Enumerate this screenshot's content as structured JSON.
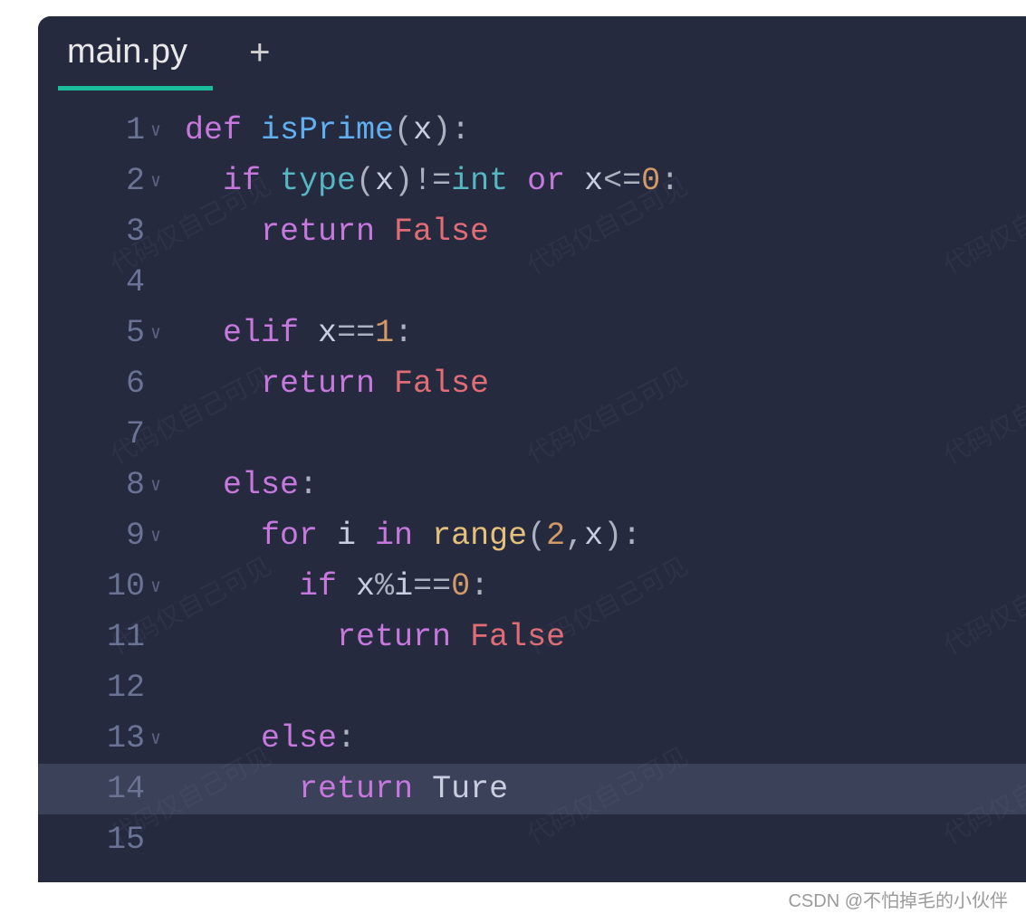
{
  "tab": {
    "filename": "main.py"
  },
  "lines": [
    {
      "num": "1",
      "fold": true,
      "highlight": false,
      "tokens": [
        {
          "t": "def ",
          "c": "tok-keyword"
        },
        {
          "t": "isPrime",
          "c": "tok-funcname"
        },
        {
          "t": "(",
          "c": "tok-punct"
        },
        {
          "t": "x",
          "c": "tok-ident"
        },
        {
          "t": "):",
          "c": "tok-punct"
        }
      ]
    },
    {
      "num": "2",
      "fold": true,
      "highlight": false,
      "tokens": [
        {
          "t": "  ",
          "c": ""
        },
        {
          "t": "if ",
          "c": "tok-keyword"
        },
        {
          "t": "type",
          "c": "tok-builtin"
        },
        {
          "t": "(",
          "c": "tok-punct"
        },
        {
          "t": "x",
          "c": "tok-ident"
        },
        {
          "t": ")",
          "c": "tok-punct"
        },
        {
          "t": "!=",
          "c": "tok-op"
        },
        {
          "t": "int ",
          "c": "tok-builtin"
        },
        {
          "t": "or ",
          "c": "tok-keyword"
        },
        {
          "t": "x",
          "c": "tok-ident"
        },
        {
          "t": "<=",
          "c": "tok-op"
        },
        {
          "t": "0",
          "c": "tok-number"
        },
        {
          "t": ":",
          "c": "tok-punct"
        }
      ]
    },
    {
      "num": "3",
      "fold": false,
      "highlight": false,
      "tokens": [
        {
          "t": "    ",
          "c": ""
        },
        {
          "t": "return ",
          "c": "tok-keyword"
        },
        {
          "t": "False",
          "c": "tok-const"
        }
      ]
    },
    {
      "num": "4",
      "fold": false,
      "highlight": false,
      "tokens": []
    },
    {
      "num": "5",
      "fold": true,
      "highlight": false,
      "tokens": [
        {
          "t": "  ",
          "c": ""
        },
        {
          "t": "elif ",
          "c": "tok-keyword"
        },
        {
          "t": "x",
          "c": "tok-ident"
        },
        {
          "t": "==",
          "c": "tok-op"
        },
        {
          "t": "1",
          "c": "tok-number"
        },
        {
          "t": ":",
          "c": "tok-punct"
        }
      ]
    },
    {
      "num": "6",
      "fold": false,
      "highlight": false,
      "tokens": [
        {
          "t": "    ",
          "c": ""
        },
        {
          "t": "return ",
          "c": "tok-keyword"
        },
        {
          "t": "False",
          "c": "tok-const"
        }
      ]
    },
    {
      "num": "7",
      "fold": false,
      "highlight": false,
      "tokens": []
    },
    {
      "num": "8",
      "fold": true,
      "highlight": false,
      "tokens": [
        {
          "t": "  ",
          "c": ""
        },
        {
          "t": "else",
          "c": "tok-keyword"
        },
        {
          "t": ":",
          "c": "tok-punct"
        }
      ]
    },
    {
      "num": "9",
      "fold": true,
      "highlight": false,
      "tokens": [
        {
          "t": "    ",
          "c": ""
        },
        {
          "t": "for ",
          "c": "tok-keyword"
        },
        {
          "t": "i ",
          "c": "tok-ident"
        },
        {
          "t": "in ",
          "c": "tok-keyword"
        },
        {
          "t": "range",
          "c": "tok-rangecall"
        },
        {
          "t": "(",
          "c": "tok-punct"
        },
        {
          "t": "2",
          "c": "tok-number"
        },
        {
          "t": ",",
          "c": "tok-punct"
        },
        {
          "t": "x",
          "c": "tok-ident"
        },
        {
          "t": "):",
          "c": "tok-punct"
        }
      ]
    },
    {
      "num": "10",
      "fold": true,
      "highlight": false,
      "tokens": [
        {
          "t": "      ",
          "c": ""
        },
        {
          "t": "if ",
          "c": "tok-keyword"
        },
        {
          "t": "x",
          "c": "tok-ident"
        },
        {
          "t": "%",
          "c": "tok-op"
        },
        {
          "t": "i",
          "c": "tok-ident"
        },
        {
          "t": "==",
          "c": "tok-op"
        },
        {
          "t": "0",
          "c": "tok-number"
        },
        {
          "t": ":",
          "c": "tok-punct"
        }
      ]
    },
    {
      "num": "11",
      "fold": false,
      "highlight": false,
      "tokens": [
        {
          "t": "        ",
          "c": ""
        },
        {
          "t": "return ",
          "c": "tok-keyword"
        },
        {
          "t": "False",
          "c": "tok-const"
        }
      ]
    },
    {
      "num": "12",
      "fold": false,
      "highlight": false,
      "tokens": []
    },
    {
      "num": "13",
      "fold": true,
      "highlight": false,
      "tokens": [
        {
          "t": "    ",
          "c": ""
        },
        {
          "t": "else",
          "c": "tok-keyword"
        },
        {
          "t": ":",
          "c": "tok-punct"
        }
      ]
    },
    {
      "num": "14",
      "fold": false,
      "highlight": true,
      "tokens": [
        {
          "t": "      ",
          "c": ""
        },
        {
          "t": "return ",
          "c": "tok-keyword"
        },
        {
          "t": "Ture",
          "c": "tok-ident"
        }
      ]
    },
    {
      "num": "15",
      "fold": false,
      "highlight": false,
      "tokens": []
    }
  ],
  "watermark_text": "代码仅自己可见",
  "attribution": "CSDN @不怕掉毛的小伙伴"
}
